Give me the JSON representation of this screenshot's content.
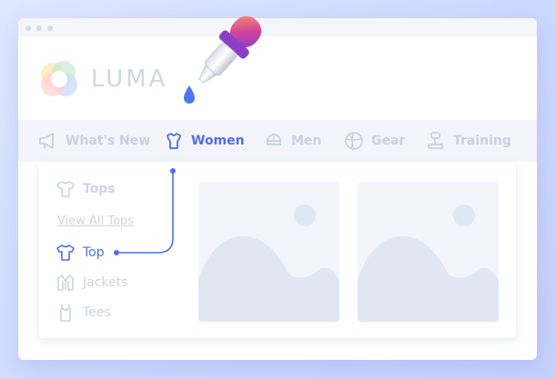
{
  "brand": {
    "name": "LUMA",
    "logo_icon": "luma-ring-logo"
  },
  "tools": {
    "eyedropper_icon": "eyedropper-icon",
    "drop_icon": "drop-icon"
  },
  "nav": {
    "items": [
      {
        "label": "What's New",
        "icon": "megaphone-icon"
      },
      {
        "label": "Women",
        "icon": "women-shirt-icon",
        "active": true
      },
      {
        "label": "Men",
        "icon": "men-cap-icon"
      },
      {
        "label": "Gear",
        "icon": "ball-icon"
      },
      {
        "label": "Training",
        "icon": "training-icon"
      }
    ]
  },
  "dropdown": {
    "heading": "Tops",
    "view_all": "View All Tops",
    "items": [
      {
        "label": "Top",
        "icon": "tshirt-icon",
        "selected": true
      },
      {
        "label": "Jackets",
        "icon": "jacket-icon"
      },
      {
        "label": "Tees",
        "icon": "tank-icon"
      }
    ]
  },
  "colors": {
    "accent": "#4f6fe0",
    "muted": "#ccd3e2",
    "panel": "#f3f5fb",
    "background": "#d6e0ff"
  }
}
